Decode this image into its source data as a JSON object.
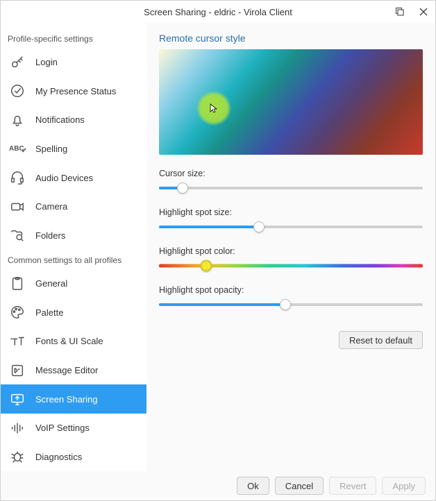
{
  "window": {
    "title": "Screen Sharing - eldric - Virola Client"
  },
  "sidebar": {
    "heading_profile": "Profile-specific settings",
    "heading_common": "Common settings to all profiles",
    "profile_items": [
      {
        "label": "Login"
      },
      {
        "label": "My Presence Status"
      },
      {
        "label": "Notifications"
      },
      {
        "label": "Spelling"
      },
      {
        "label": "Audio Devices"
      },
      {
        "label": "Camera"
      },
      {
        "label": "Folders"
      }
    ],
    "common_items": [
      {
        "label": "General"
      },
      {
        "label": "Palette"
      },
      {
        "label": "Fonts & UI Scale"
      },
      {
        "label": "Message Editor"
      },
      {
        "label": "Screen Sharing"
      },
      {
        "label": "VoIP Settings"
      },
      {
        "label": "Diagnostics"
      }
    ]
  },
  "content": {
    "section_title": "Remote cursor style",
    "cursor_size_label": "Cursor size:",
    "cursor_size_pct": 9,
    "highlight_size_label": "Highlight spot size:",
    "highlight_size_pct": 38,
    "highlight_color_label": "Highlight spot color:",
    "highlight_color_pct": 18,
    "highlight_opacity_label": "Highlight spot opacity:",
    "highlight_opacity_pct": 48,
    "reset_label": "Reset to default"
  },
  "footer": {
    "ok": "Ok",
    "cancel": "Cancel",
    "revert": "Revert",
    "apply": "Apply"
  }
}
